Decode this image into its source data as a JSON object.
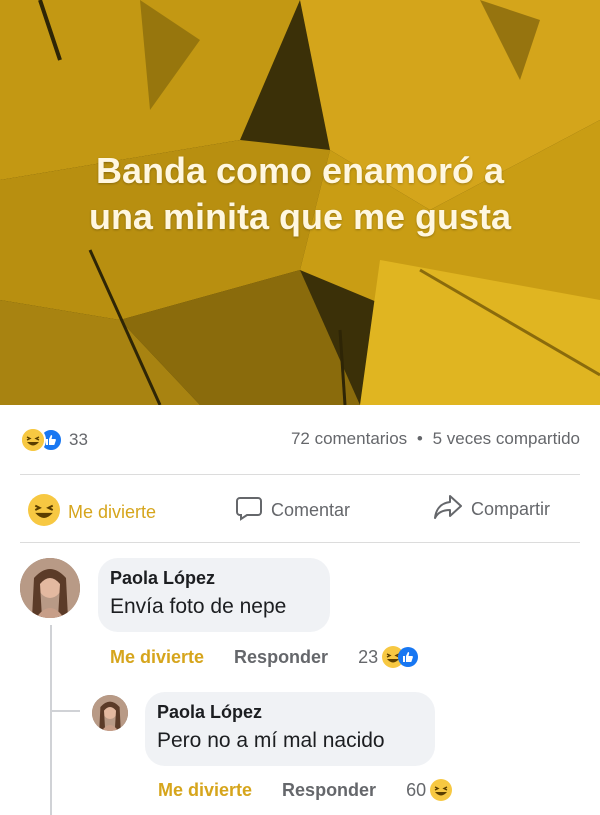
{
  "post": {
    "text_line1": "Banda como enamoró a",
    "text_line2": "una minita que me gusta",
    "background_color": "#c69a12"
  },
  "stats": {
    "reaction_count": "33",
    "comments": "72 comentarios",
    "separator": "•",
    "shares": "5 veces compartido"
  },
  "actions": {
    "react_label": "Me divierte",
    "comment_label": "Comentar",
    "share_label": "Compartir"
  },
  "comments": [
    {
      "author": "Paola López",
      "text": "Envía foto de nepe",
      "react_label": "Me divierte",
      "reply_label": "Responder",
      "reaction_count": "23"
    },
    {
      "author": "Paola López",
      "text": "Pero no a mí mal nacido",
      "react_label": "Me divierte",
      "reply_label": "Responder",
      "reaction_count": "60"
    }
  ]
}
